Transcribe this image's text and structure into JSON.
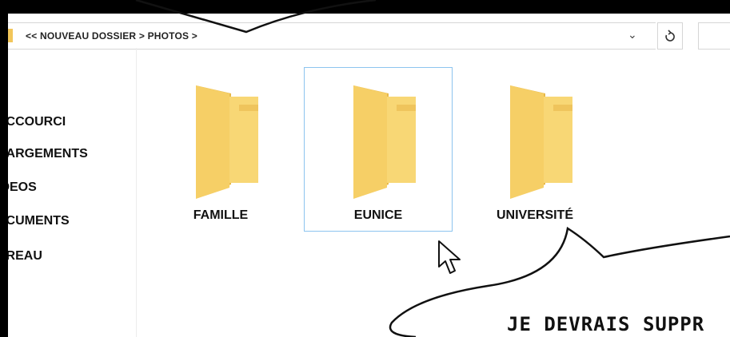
{
  "explorer": {
    "breadcrumb": "<< NOUVEAU DOSSIER > PHOTOS >",
    "address_dropdown_icon": "chevron-down-icon",
    "refresh_icon": "refresh-icon"
  },
  "sidebar": {
    "items": [
      {
        "label": "ACCOURCI"
      },
      {
        "label": "HARGEMENTS"
      },
      {
        "label": "IDEOS"
      },
      {
        "label": "CCUMENTS"
      },
      {
        "label": "UREAU"
      }
    ]
  },
  "folders": [
    {
      "label": "FAMILLE",
      "selected": false
    },
    {
      "label": "EUNICE",
      "selected": true
    },
    {
      "label": "UNIVERSITÉ",
      "selected": false
    }
  ],
  "speech_bubble": {
    "text": "JE DEVRAIS SUPPR"
  },
  "colors": {
    "folder_front": "#f8d775",
    "folder_back": "#e8b94a",
    "selection_border": "#8cc4ef"
  }
}
